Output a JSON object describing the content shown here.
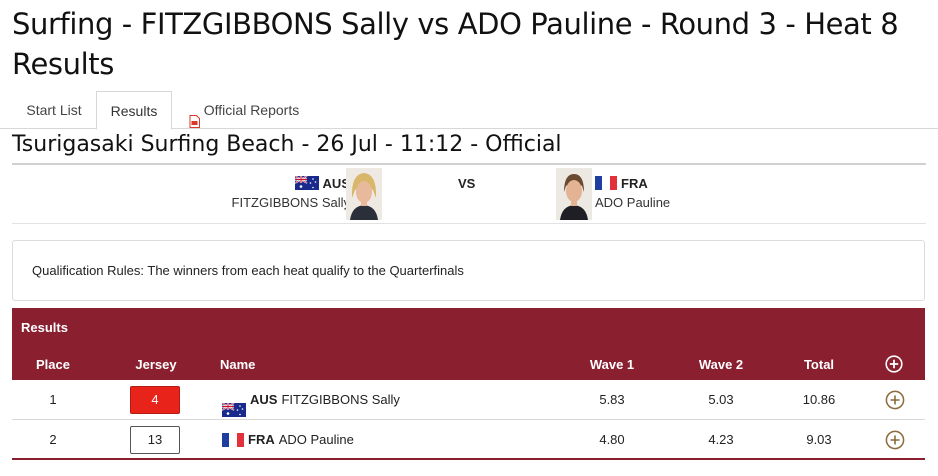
{
  "page": {
    "title": "Surfing - FITZGIBBONS Sally vs ADO Pauline - Round 3 - Heat 8 Results"
  },
  "tabs": {
    "start_list": "Start List",
    "results": "Results",
    "official_reports": "Official Reports"
  },
  "event": {
    "venue_line": "Tsurigasaki Surfing Beach - 26 Jul - 11:12 - Official"
  },
  "matchup": {
    "vs_label": "VS",
    "left": {
      "noc": "AUS",
      "name": "FITZGIBBONS Sally"
    },
    "right": {
      "noc": "FRA",
      "name": "ADO Pauline"
    }
  },
  "qualification": {
    "text": "Qualification Rules: The winners from each heat qualify to the Quarterfinals"
  },
  "results": {
    "heading": "Results",
    "columns": {
      "place": "Place",
      "jersey": "Jersey",
      "name": "Name",
      "wave1": "Wave 1",
      "wave2": "Wave 2",
      "total": "Total"
    },
    "rows": [
      {
        "place": "1",
        "jersey": "4",
        "jersey_color": "#e8231a",
        "noc": "AUS",
        "name": "FITZGIBBONS Sally",
        "wave1": "5.83",
        "wave2": "5.03",
        "total": "10.86"
      },
      {
        "place": "2",
        "jersey": "13",
        "jersey_color": "#ffffff",
        "noc": "FRA",
        "name": "ADO Pauline",
        "wave1": "4.80",
        "wave2": "4.23",
        "total": "9.03"
      }
    ]
  },
  "colors": {
    "header_band": "#8a1f30",
    "expand_icon": "#8b6a3a",
    "pdf_icon": "#d9382b"
  }
}
